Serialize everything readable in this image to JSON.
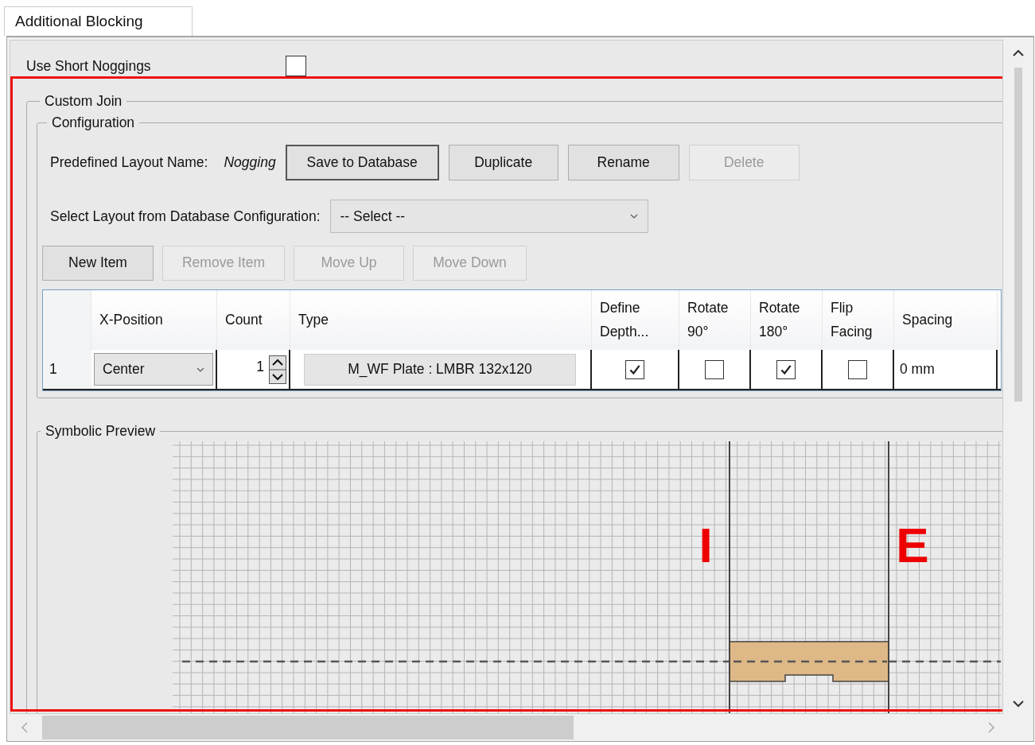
{
  "tab": {
    "label": "Additional Blocking",
    "selected": true
  },
  "use_short_noggings": {
    "label": "Use Short Noggings",
    "checked": false
  },
  "custom_join": {
    "title": "Custom Join",
    "configuration": {
      "title": "Configuration",
      "layout_name_label": "Predefined Layout Name:",
      "layout_name": "Nogging",
      "layout_actions": [
        {
          "label": "Save to Database",
          "disabled": false
        },
        {
          "label": "Duplicate",
          "disabled": false
        },
        {
          "label": "Rename",
          "disabled": false
        },
        {
          "label": "Delete",
          "disabled": true
        }
      ],
      "select_label": "Select Layout from Database Configuration:",
      "select_value": "-- Select --",
      "item_actions": [
        {
          "label": "New Item",
          "disabled": false
        },
        {
          "label": "Remove Item",
          "disabled": true
        },
        {
          "label": "Move Up",
          "disabled": true
        },
        {
          "label": "Move Down",
          "disabled": true
        }
      ],
      "table": {
        "columns": [
          "X-Position",
          "Count",
          "Type",
          "Define Depth...",
          "Rotate 90°",
          "Rotate 180°",
          "Flip Facing",
          "Spacing"
        ],
        "rows": [
          {
            "number": "1",
            "x_position": "Center",
            "count": "1",
            "type": "M_WF Plate : LMBR 132x120",
            "define_depth": true,
            "rotate_90": false,
            "rotate_180": true,
            "flip_facing": false,
            "spacing": "0 mm"
          }
        ]
      }
    },
    "symbolic_preview": {
      "title": "Symbolic Preview",
      "interior_label": "I",
      "exterior_label": "E"
    }
  }
}
